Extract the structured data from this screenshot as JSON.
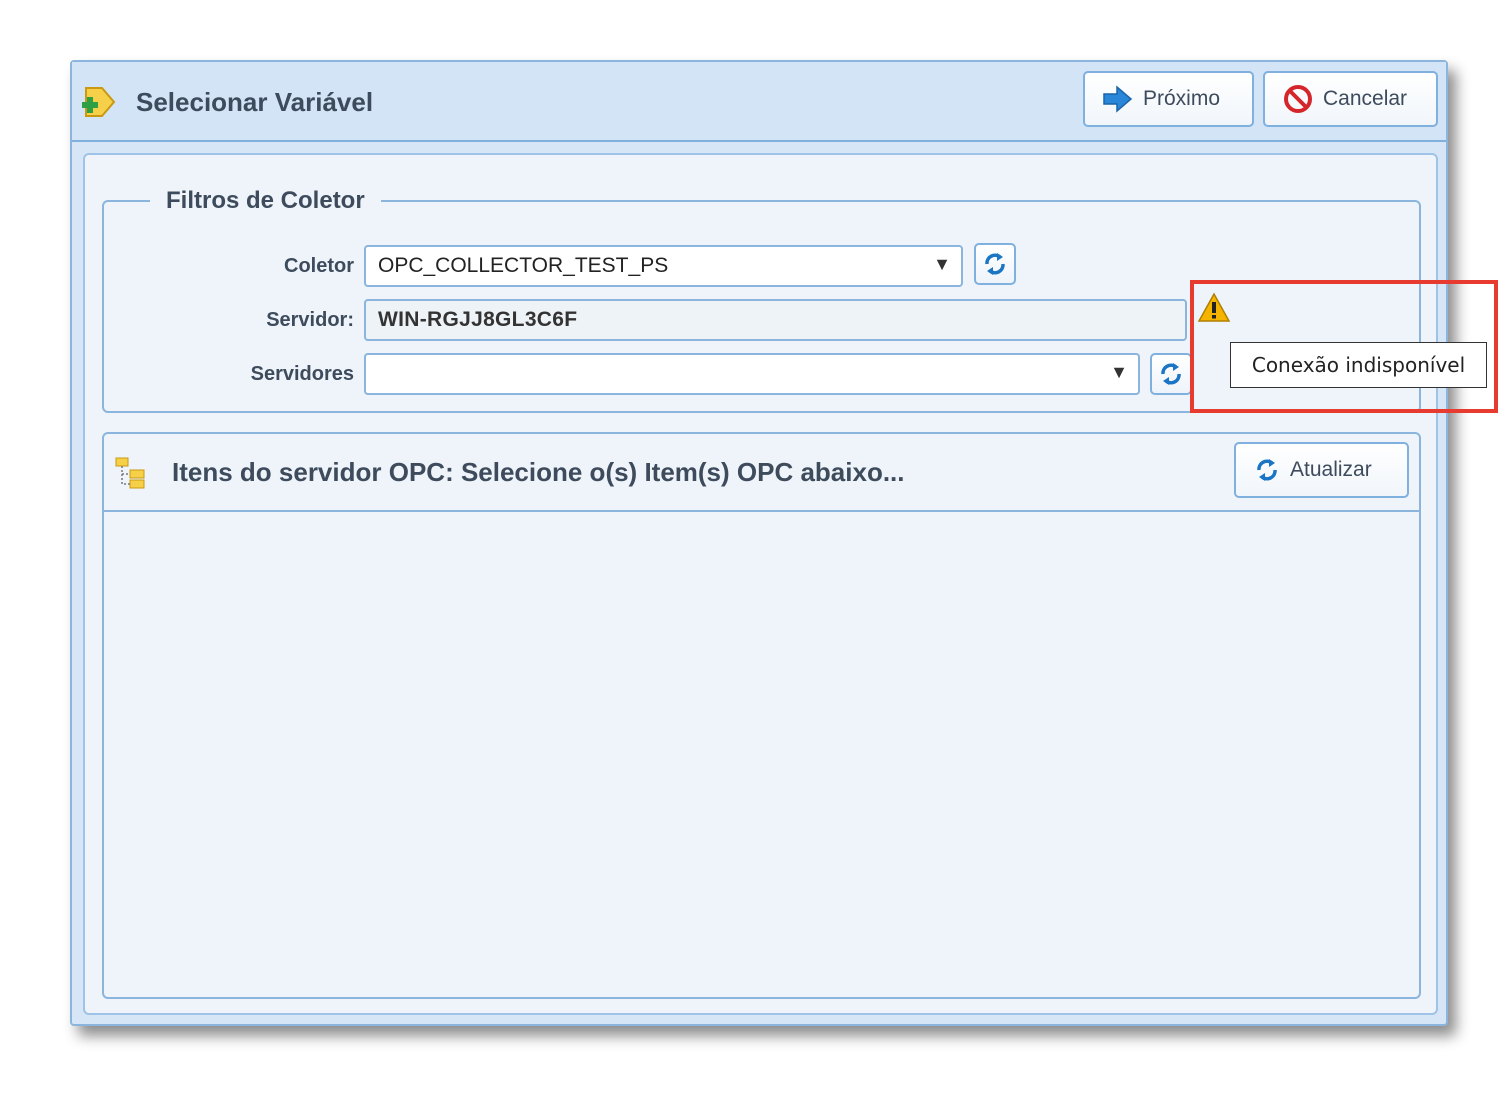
{
  "dialog": {
    "title": "Selecionar Variável",
    "header_icon": "add-variable-icon",
    "next_button": {
      "label": "Próximo",
      "icon": "arrow-right-icon"
    },
    "cancel_button": {
      "label": "Cancelar",
      "icon": "cancel-icon"
    }
  },
  "filters": {
    "legend": "Filtros de Coletor",
    "collector_label": "Coletor",
    "collector_value": "OPC_COLLECTOR_TEST_PS",
    "server_label": "Servidor:",
    "server_value": "WIN-RGJJ8GL3C6F",
    "servers_label": "Servidores",
    "servers_value": "",
    "warning_icon": "warning-icon",
    "tooltip": "Conexão indisponível"
  },
  "items": {
    "title": "Itens do servidor OPC: Selecione o(s) Item(s) OPC abaixo...",
    "icon": "tree-items-icon",
    "update_button": {
      "label": "Atualizar",
      "icon": "refresh-icon"
    }
  },
  "colors": {
    "accent": "#1a75c4",
    "highlight": "#e63b2e",
    "warning": "#f5b400"
  }
}
